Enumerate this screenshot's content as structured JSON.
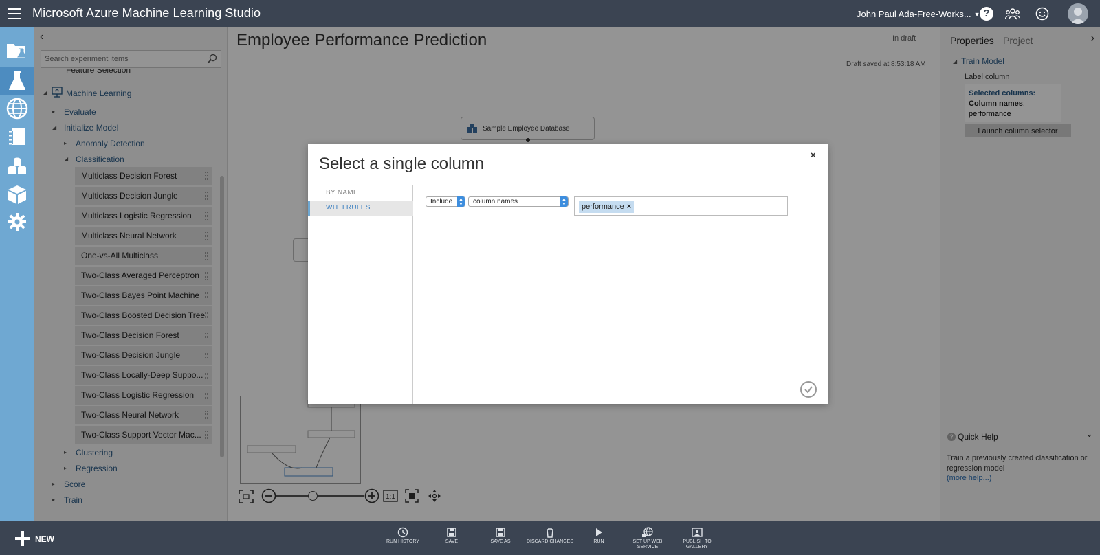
{
  "topbar": {
    "app_title": "Microsoft Azure Machine Learning Studio",
    "workspace": "John Paul Ada-Free-Works...",
    "help": "?"
  },
  "leftnav": {
    "items": [
      "projects-icon",
      "experiments-icon",
      "web-services-icon",
      "notebooks-icon",
      "datasets-icon",
      "trained-models-icon",
      "settings-icon"
    ],
    "active": "experiments-icon"
  },
  "palette": {
    "search_placeholder": "Search experiment items",
    "partial_item": "Feature Selection",
    "machine_learning": "Machine Learning",
    "evaluate": "Evaluate",
    "initialize_model": "Initialize Model",
    "anomaly_detection": "Anomaly Detection",
    "classification": "Classification",
    "classifiers": [
      "Multiclass Decision Forest",
      "Multiclass Decision Jungle",
      "Multiclass Logistic Regression",
      "Multiclass Neural Network",
      "One-vs-All Multiclass",
      "Two-Class Averaged Perceptron",
      "Two-Class Bayes Point Machine",
      "Two-Class Boosted Decision Tree",
      "Two-Class Decision Forest",
      "Two-Class Decision Jungle",
      "Two-Class Locally-Deep Suppo...",
      "Two-Class Logistic Regression",
      "Two-Class Neural Network",
      "Two-Class Support Vector Mac..."
    ],
    "clustering": "Clustering",
    "regression": "Regression",
    "score": "Score",
    "train": "Train"
  },
  "canvas": {
    "experiment_title": "Employee Performance Prediction",
    "status": "In draft",
    "draft_saved": "Draft saved at 8:53:18 AM",
    "module_sample_db": "Sample Employee Database"
  },
  "properties": {
    "tab_properties": "Properties",
    "tab_project": "Project",
    "module_name": "Train Model",
    "label_column": "Label column",
    "selected_columns": "Selected columns:",
    "column_names": "Column names",
    "column_names_suffix": ":",
    "column_value": "performance",
    "launch_button": "Launch column selector",
    "quick_help_title": "Quick Help",
    "quick_help_text": "Train a previously created classification or regression model",
    "more_help": "(more help...)"
  },
  "modal": {
    "title": "Select a single column",
    "close": "×",
    "by_name": "BY NAME",
    "with_rules": "WITH RULES",
    "include_select": "Include",
    "colnames_select": "column names",
    "token": "performance",
    "token_remove": "×"
  },
  "bottombar": {
    "new_label": "NEW",
    "run_history": "RUN HISTORY",
    "save": "SAVE",
    "save_as": "SAVE AS",
    "discard_changes": "DISCARD CHANGES",
    "run": "RUN",
    "setup_web_service_1": "SET UP WEB",
    "setup_web_service_2": "SERVICE",
    "publish_gallery_1": "PUBLISH TO",
    "publish_gallery_2": "GALLERY"
  },
  "colors": {
    "topbar": "#3b4452",
    "leftnav": "#6fa8d2",
    "accent": "#3b7fc0"
  }
}
